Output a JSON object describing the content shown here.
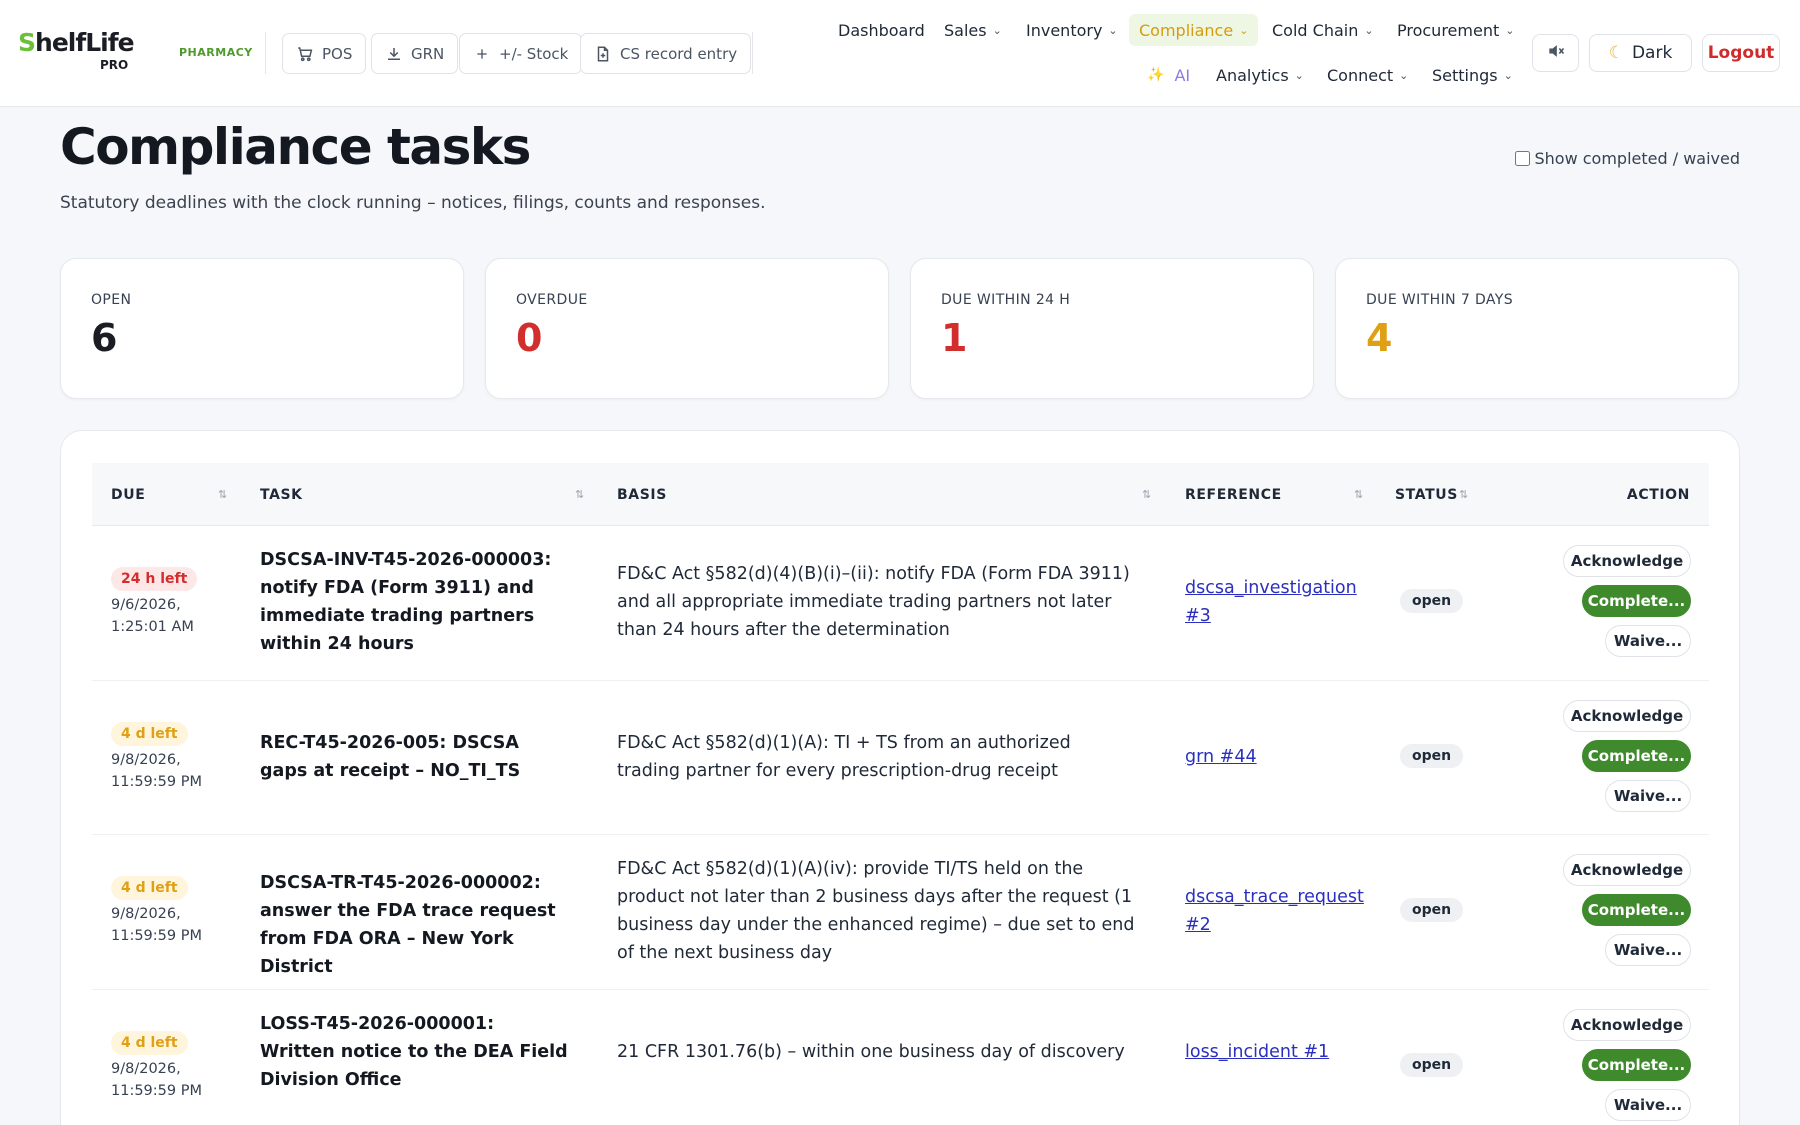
{
  "brand": {
    "name_accent": "S",
    "name_rest": "helfLife",
    "sub": "PRO",
    "tag": "PHARMACY",
    "accent_color": "#6bbf3a"
  },
  "quick_actions": [
    {
      "label": "POS",
      "icon": "cart-icon"
    },
    {
      "label": "GRN",
      "icon": "download-icon"
    },
    {
      "label": "+/- Stock",
      "icon": "plus-icon"
    },
    {
      "label": "CS record entry",
      "icon": "document-icon"
    }
  ],
  "nav": {
    "dashboard": "Dashboard",
    "sales": "Sales",
    "inventory": "Inventory",
    "compliance": "Compliance",
    "cold_chain": "Cold Chain",
    "procurement": "Procurement",
    "ai": "AI",
    "analytics": "Analytics",
    "connect": "Connect",
    "settings": "Settings"
  },
  "header_controls": {
    "theme_label": "Dark",
    "logout_label": "Logout"
  },
  "page": {
    "title": "Compliance tasks",
    "subtitle": "Statutory deadlines with the clock running – notices, filings, counts and responses.",
    "show_completed_label": "Show completed / waived",
    "show_completed_checked": false
  },
  "stats": [
    {
      "label": "OPEN",
      "value": "6",
      "color": "#1a1d23"
    },
    {
      "label": "OVERDUE",
      "value": "0",
      "color": "#d22e2e"
    },
    {
      "label": "DUE WITHIN 24 H",
      "value": "1",
      "color": "#d22e2e"
    },
    {
      "label": "DUE WITHIN 7 DAYS",
      "value": "4",
      "color": "#e0a016"
    }
  ],
  "table": {
    "columns": {
      "due": "DUE",
      "task": "TASK",
      "basis": "BASIS",
      "reference": "REFERENCE",
      "status": "STATUS",
      "action": "ACTION"
    },
    "actions": {
      "acknowledge": "Acknowledge",
      "complete": "Complete...",
      "waive": "Waive..."
    },
    "rows": [
      {
        "badge": "24 h left",
        "badge_tone": "red",
        "date": "9/6/2026,",
        "time": "1:25:01 AM",
        "task": "DSCSA-INV-T45-2026-000003: notify FDA (Form 3911) and immediate trading partners within 24 hours",
        "basis": "FD&C Act §582(d)(4)(B)(i)–(ii): notify FDA (Form FDA 3911) and all appropriate immediate trading partners not later than 24 hours after the determination",
        "reference": "dscsa_investigation #3",
        "status": "open"
      },
      {
        "badge": "4 d left",
        "badge_tone": "amber",
        "date": "9/8/2026,",
        "time": "11:59:59 PM",
        "task": "REC-T45-2026-005: DSCSA gaps at receipt – NO_TI_TS",
        "basis": "FD&C Act §582(d)(1)(A): TI + TS from an authorized trading partner for every prescription-drug receipt",
        "reference": "grn #44",
        "status": "open"
      },
      {
        "badge": "4 d left",
        "badge_tone": "amber",
        "date": "9/8/2026,",
        "time": "11:59:59 PM",
        "task": "DSCSA-TR-T45-2026-000002: answer the FDA trace request from FDA ORA – New York District",
        "basis": "FD&C Act §582(d)(1)(A)(iv): provide TI/TS held on the product not later than 2 business days after the request (1 business day under the enhanced regime) – due set to end of the next business day",
        "reference": "dscsa_trace_request #2",
        "status": "open"
      },
      {
        "badge": "4 d left",
        "badge_tone": "amber",
        "date": "9/8/2026,",
        "time": "11:59:59 PM",
        "task": "LOSS-T45-2026-000001: Written notice to the DEA Field Division Office",
        "basis": "21 CFR 1301.76(b) – within one business day of discovery",
        "reference": "loss_incident #1",
        "status": "open"
      }
    ]
  }
}
